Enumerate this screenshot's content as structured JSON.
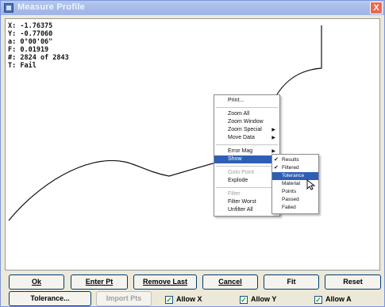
{
  "window": {
    "title": "Measure Profile",
    "close_label": "X"
  },
  "readout": {
    "x": "X: -1.76375",
    "y": "Y: -0.77060",
    "a": "a: 0°00'06\"",
    "f": "F: 0.01919",
    "n": "#: 2824 of 2843",
    "t": "T: Fail"
  },
  "context_menu": {
    "items": [
      {
        "label": "Print..."
      },
      {
        "label": "Zoom All"
      },
      {
        "label": "Zoom Window"
      },
      {
        "label": "Zoom Special"
      },
      {
        "label": "Move Data"
      },
      {
        "label": "Error Mag"
      },
      {
        "label": "Show"
      },
      {
        "label": "Goto Point"
      },
      {
        "label": "Explode"
      },
      {
        "label": "Filter"
      },
      {
        "label": "Filter Worst"
      },
      {
        "label": "Unfilter All"
      }
    ]
  },
  "show_submenu": {
    "items": [
      {
        "label": "Results",
        "checked": true
      },
      {
        "label": "Filtered",
        "checked": true
      },
      {
        "label": "Tolerance",
        "checked": false
      },
      {
        "label": "Material",
        "checked": false
      },
      {
        "label": "Points",
        "checked": false
      },
      {
        "label": "Passed",
        "checked": false
      },
      {
        "label": "Failed",
        "checked": false
      }
    ]
  },
  "buttons": {
    "ok": "Ok",
    "enter_pt": "Enter Pt",
    "remove_last": "Remove Last",
    "cancel": "Cancel",
    "fit": "Fit",
    "reset": "Reset",
    "tolerance": "Tolerance...",
    "import_pts": "Import Pts"
  },
  "checkboxes": {
    "allow_x": "Allow X",
    "allow_y": "Allow Y",
    "allow_a": "Allow A"
  },
  "colors": {
    "title_bar": "#a9bde9",
    "highlight": "#2f5fb3",
    "close": "#e86a4c"
  }
}
